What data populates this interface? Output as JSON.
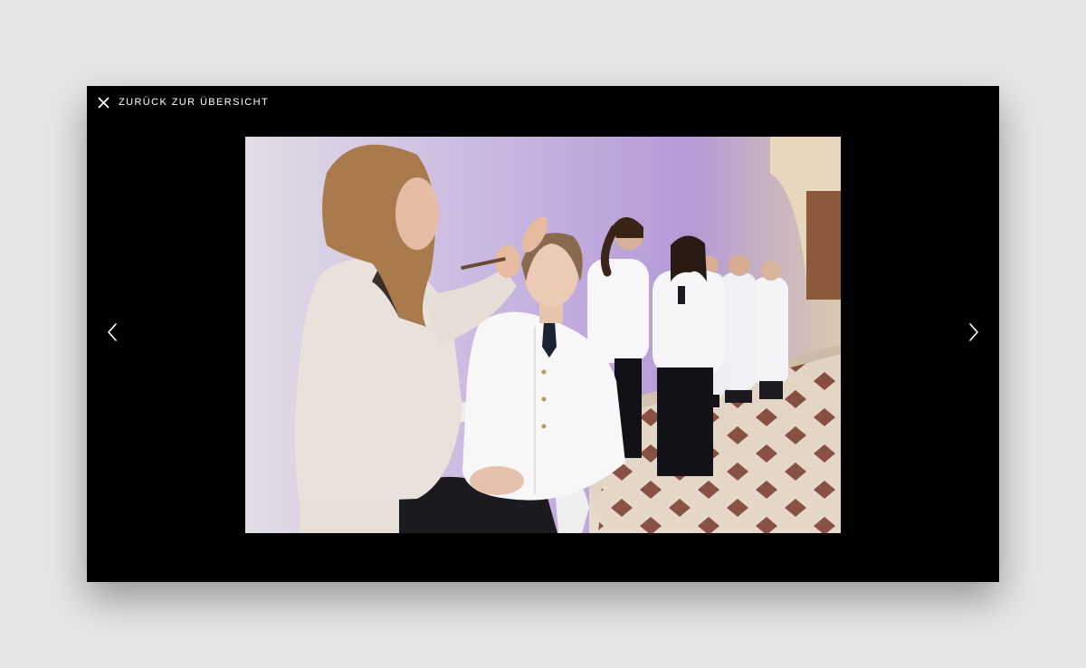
{
  "viewer": {
    "back_label": "ZURÜCK ZUR ÜBERSICHT"
  },
  "icons": {
    "close": "close-icon",
    "prev": "chevron-left-icon",
    "next": "chevron-right-icon"
  },
  "colors": {
    "page_background": "#e6e6e6",
    "lightbox_background": "#000000",
    "foreground": "#ffffff"
  }
}
